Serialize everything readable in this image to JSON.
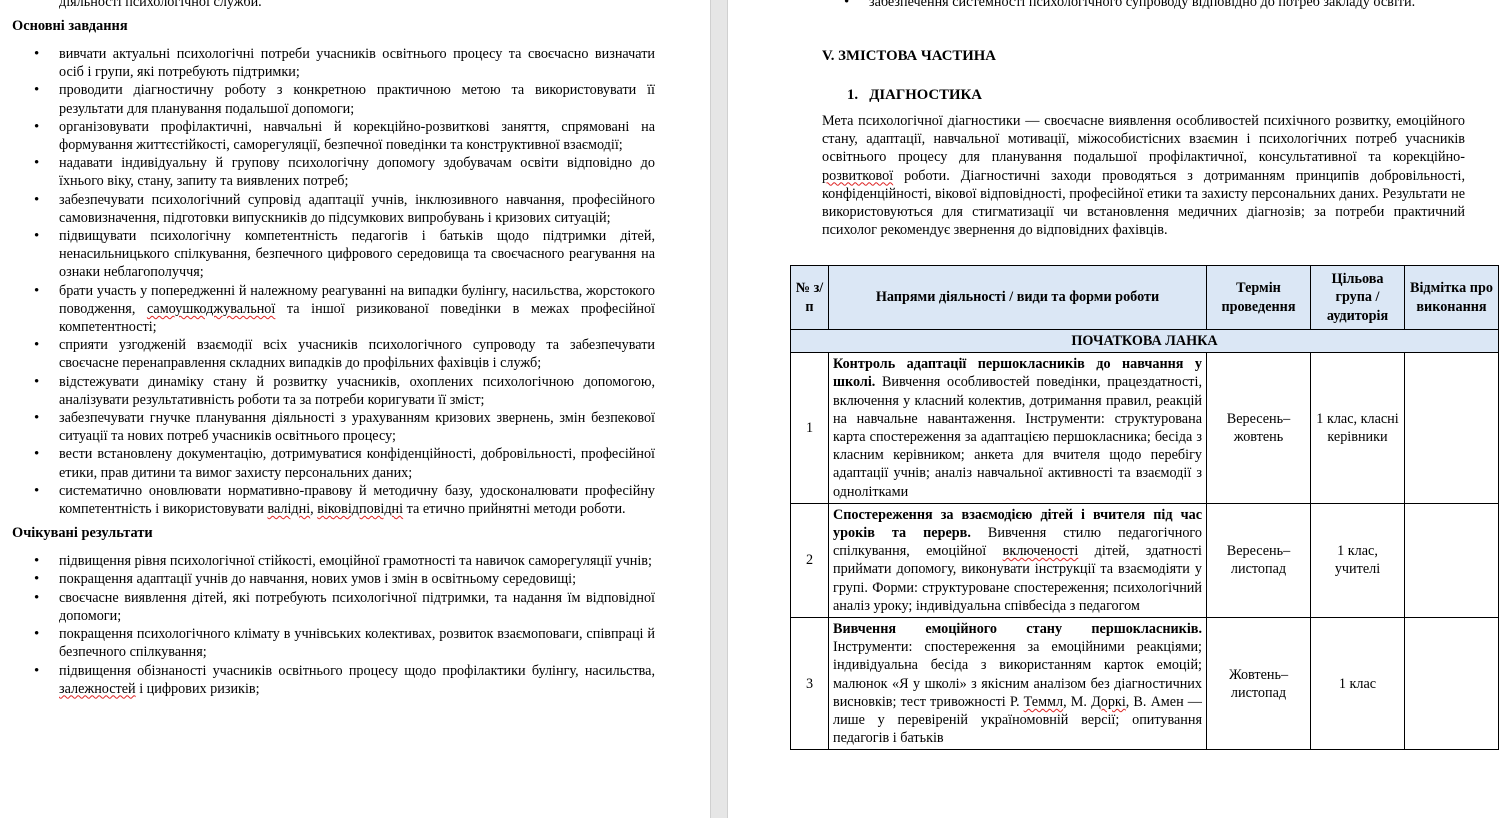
{
  "left_page": {
    "top_fragment": "діяльності психологічної служби.",
    "tasks_heading": "Основні завдання",
    "tasks": [
      "вивчати актуальні психологічні потреби учасників освітнього процесу та своєчасно визначати осіб і групи, які потребують підтримки;",
      "проводити діагностичну роботу з конкретною практичною метою та використовувати її результати для планування подальшої допомоги;",
      "організовувати профілактичні, навчальні й корекційно-розвиткові заняття, спрямовані на формування життєстійкості, саморегуляції, безпечної поведінки та конструктивної взаємодії;",
      "надавати індивідуальну й групову психологічну допомогу здобувачам освіти відповідно до їхнього віку, стану, запиту та виявлених потреб;",
      "забезпечувати психологічний супровід адаптації учнів, інклюзивного навчання, професійного самовизначення, підготовки випускників до підсумкових випробувань і кризових ситуацій;",
      "підвищувати психологічну компетентність педагогів і батьків щодо підтримки дітей, ненасильницького спілкування, безпечного цифрового середовища та своєчасного реагування на ознаки неблагополуччя;",
      "брати участь у попередженні й належному реагуванні на випадки булінгу, насильства, жорстокого поводження, самоушкоджувальної та іншої ризикованої поведінки в межах професійної компетентності;",
      "сприяти узгодженій взаємодії всіх учасників психологічного супроводу та забезпечувати своєчасне перенаправлення складних випадків до профільних фахівців і служб;",
      "відстежувати динаміку стану й розвитку учасників, охоплених психологічною допомогою, аналізувати результативність роботи та за потреби коригувати її зміст;",
      "забезпечувати гнучке планування діяльності з урахуванням кризових звернень, змін безпекової ситуації та нових потреб учасників освітнього процесу;",
      "вести встановлену документацію, дотримуватися конфіденційності, добровільності, професійної етики, прав дитини та вимог захисту персональних даних;",
      "систематично оновлювати нормативно-правову й методичну базу, удосконалювати професійну компетентність і використовувати валідні, віковідповідні та етично прийнятні методи роботи."
    ],
    "results_heading": "Очікувані результати",
    "results": [
      "підвищення рівня психологічної стійкості, емоційної грамотності та навичок саморегуляції учнів;",
      "покращення адаптації учнів до навчання, нових умов і змін в освітньому середовищі;",
      "своєчасне виявлення дітей, які потребують психологічної підтримки, та надання їм відповідної допомоги;",
      "покращення психологічного клімату в учнівських колективах, розвиток взаємоповаги, співпраці й безпечного спілкування;",
      "підвищення обізнаності учасників освітнього процесу щодо профілактики булінгу, насильства, залежностей і цифрових ризиків;"
    ]
  },
  "right_page": {
    "top_item": "забезпечення системності психологічного супроводу відповідно до потреб закладу освіти.",
    "section_title": "V. ЗМІСТОВА ЧАСТИНА",
    "subsection_number": "1.",
    "subsection_title": "ДІАГНОСТИКА",
    "intro": "Мета психологічної діагностики — своєчасне виявлення особливостей психічного розвитку, емоційного стану, адаптації, навчальної мотивації, міжособистісних взаємин і психологічних потреб учасників освітнього процесу для планування подальшої профілактичної, консультативної та корекційно-розвиткової роботи. Діагностичні заходи проводяться з дотриманням принципів добровільності, конфіденційності, вікової відповідності, професійної етики та захисту персональних даних. Результати не використовуються для стигматизації чи встановлення медичних діагнозів; за потреби практичний психолог рекомендує звернення до відповідних фахівців.",
    "table": {
      "headers": {
        "num": "№ з/п",
        "activity": "Напрями діяльності / види та форми роботи",
        "term": "Термін проведення",
        "target": "Цільова група / аудиторія",
        "mark": "Відмітка про виконання"
      },
      "band": "ПОЧАТКОВА ЛАНКА",
      "rows": [
        {
          "num": "1",
          "title": "Контроль адаптації першокласників до навчання у школі.",
          "text": " Вивчення особливостей поведінки, працездатності, включення у класний колектив, дотримання правил, реакцій на навчальне навантаження. Інструменти: структурована карта спостереження за адаптацією першокласника; бесіда з класним керівником; анкета для вчителя щодо перебігу адаптації учнів; аналіз навчальної активності та взаємодії з однолітками",
          "term": "Вересень–жовтень",
          "target": "1 клас, класні керівники",
          "mark": ""
        },
        {
          "num": "2",
          "title": "Спостереження за взаємодією дітей і вчителя під час уроків та перерв.",
          "text": " Вивчення стилю педагогічного спілкування, емоційної включеності дітей, здатності приймати допомогу, виконувати інструкції та взаємодіяти у групі. Форми: структуроване спостереження; психологічний аналіз уроку; індивідуальна співбесіда з педагогом",
          "term": "Вересень–листопад",
          "target": "1 клас, учителі",
          "mark": ""
        },
        {
          "num": "3",
          "title": "Вивчення емоційного стану першокласників.",
          "text": " Інструменти: спостереження за емоційними реакціями; індивідуальна бесіда з використанням карток емоцій; малюнок «Я у школі» з якісним аналізом без діагностичних висновків; тест тривожності Р. Теммл, М. Доркі, В. Амен — лише у перевіреній україномовній версії; опитування педагогів і батьків",
          "term": "Жовтень–листопад",
          "target": "1 клас",
          "mark": ""
        }
      ]
    }
  }
}
